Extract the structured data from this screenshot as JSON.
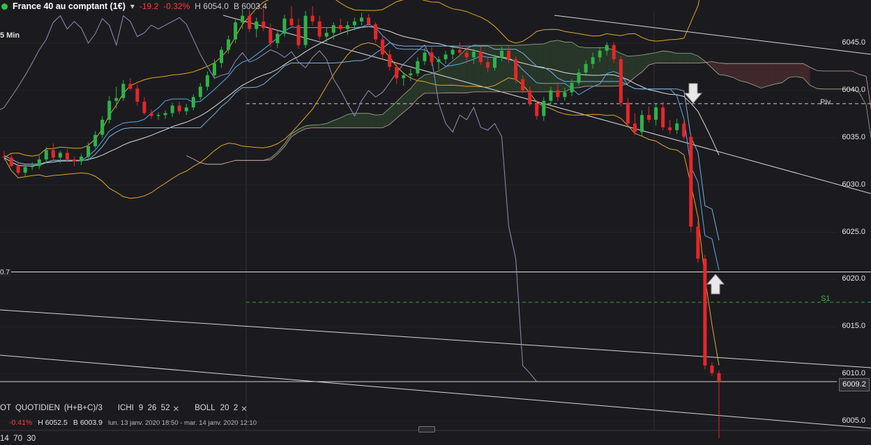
{
  "header": {
    "instrument": "France 40 au comptant (1€)",
    "change": "-19.2",
    "change_pct": "-0.32%",
    "high": "H 6054.0",
    "bid": "B 6003.4"
  },
  "timeframe_label": "5 Min",
  "price_axis": [
    "6045.0",
    "6040.0",
    "6035.0",
    "6030.0",
    "6025.0",
    "6020.0",
    "6015.0",
    "6010.0",
    "6005.0"
  ],
  "current_price": "6009.2",
  "left_tag": "0.7",
  "levels": {
    "pivot_label": "Piv",
    "s1_label": "S1"
  },
  "indicators": {
    "pivot_prefix": "OT",
    "pivot_type": "QUOTIDIEN",
    "pivot_formula": "(H+B+C)/3",
    "ichi_name": "ICHI",
    "ichi_params": "9  26  52",
    "boll_name": "BOLL",
    "boll_params": "20  2",
    "close_glyph": "✕"
  },
  "info": {
    "pct": "-0.41%",
    "high": "H 6052.5",
    "bid": "B 6003.9",
    "range": "lun. 13 janv. 2020 18:50 - mar. 14 janv. 2020 12:10"
  },
  "oscillator_params": "14  70  30",
  "colors": {
    "bull": "#2db34a",
    "bear": "#e8252a",
    "bollinger": "#e2a62a",
    "tenkan": "#5aa9e6",
    "kijun": "#e6e6e6",
    "chikou": "#8f8fb8",
    "cloud_green": "#2a3d2a",
    "cloud_red": "#4a2a2e",
    "pivot": "#d0d0d0",
    "s1": "#3f9c3f"
  },
  "chart_data": {
    "type": "candlestick",
    "timeframe": "5 Min",
    "ylim": [
      6003,
      6049
    ],
    "pivot": 6038.6,
    "s1": 6017.6,
    "horizontal_line": 6020.8,
    "current_line": 6009.2,
    "candles": [
      [
        6033.0,
        6033.6,
        6032.6,
        6032.9
      ],
      [
        6032.9,
        6033.3,
        6031.9,
        6032.0
      ],
      [
        6032.0,
        6032.5,
        6031.1,
        6031.3
      ],
      [
        6031.3,
        6032.2,
        6030.8,
        6031.9
      ],
      [
        6031.9,
        6032.4,
        6031.6,
        6032.0
      ],
      [
        6032.0,
        6033.1,
        6031.7,
        6032.7
      ],
      [
        6032.7,
        6034.0,
        6032.3,
        6033.7
      ],
      [
        6033.7,
        6034.4,
        6032.6,
        6032.9
      ],
      [
        6032.9,
        6033.6,
        6032.3,
        6033.4
      ],
      [
        6033.4,
        6033.8,
        6032.4,
        6032.7
      ],
      [
        6032.7,
        6033.0,
        6032.0,
        6032.5
      ],
      [
        6032.5,
        6033.3,
        6032.1,
        6033.0
      ],
      [
        6033.0,
        6034.5,
        6032.6,
        6034.1
      ],
      [
        6034.1,
        6035.7,
        6033.9,
        6035.3
      ],
      [
        6035.3,
        6037.3,
        6035.0,
        6036.9
      ],
      [
        6036.9,
        6039.4,
        6036.5,
        6038.9
      ],
      [
        6038.9,
        6040.4,
        6038.1,
        6039.2
      ],
      [
        6039.2,
        6041.1,
        6038.9,
        6040.7
      ],
      [
        6040.7,
        6041.3,
        6040.0,
        6040.2
      ],
      [
        6040.2,
        6040.6,
        6038.4,
        6038.8
      ],
      [
        6038.8,
        6039.3,
        6037.4,
        6037.6
      ],
      [
        6037.6,
        6038.0,
        6037.0,
        6037.3
      ],
      [
        6037.3,
        6037.7,
        6036.9,
        6037.4
      ],
      [
        6037.4,
        6037.9,
        6037.0,
        6037.6
      ],
      [
        6037.6,
        6038.7,
        6037.2,
        6038.4
      ],
      [
        6038.4,
        6038.8,
        6037.5,
        6037.8
      ],
      [
        6037.8,
        6038.6,
        6037.4,
        6038.2
      ],
      [
        6038.2,
        6039.6,
        6037.9,
        6039.3
      ],
      [
        6039.3,
        6040.8,
        6039.0,
        6040.4
      ],
      [
        6040.4,
        6042.0,
        6040.0,
        6041.6
      ],
      [
        6041.6,
        6043.3,
        6041.2,
        6042.9
      ],
      [
        6042.9,
        6044.6,
        6042.4,
        6044.3
      ],
      [
        6044.3,
        6045.8,
        6043.9,
        6045.4
      ],
      [
        6045.4,
        6047.5,
        6045.0,
        6047.2
      ],
      [
        6047.2,
        6048.6,
        6046.5,
        6047.9
      ],
      [
        6047.9,
        6048.5,
        6046.2,
        6046.5
      ],
      [
        6046.5,
        6047.7,
        6045.6,
        6047.3
      ],
      [
        6047.3,
        6048.7,
        6046.3,
        6046.6
      ],
      [
        6046.6,
        6047.1,
        6044.6,
        6045.0
      ],
      [
        6045.0,
        6046.4,
        6044.5,
        6046.0
      ],
      [
        6046.0,
        6048.0,
        6045.7,
        6047.6
      ],
      [
        6047.6,
        6048.9,
        6046.6,
        6046.9
      ],
      [
        6046.9,
        6047.6,
        6044.4,
        6044.8
      ],
      [
        6044.8,
        6048.4,
        6044.5,
        6047.9
      ],
      [
        6047.9,
        6048.9,
        6046.9,
        6047.3
      ],
      [
        6047.3,
        6047.9,
        6045.4,
        6045.7
      ],
      [
        6045.7,
        6046.6,
        6045.1,
        6046.1
      ],
      [
        6046.1,
        6047.2,
        6045.4,
        6046.9
      ],
      [
        6046.9,
        6047.6,
        6046.1,
        6046.5
      ],
      [
        6046.5,
        6047.3,
        6045.9,
        6046.9
      ],
      [
        6046.9,
        6047.7,
        6046.4,
        6047.3
      ],
      [
        6047.3,
        6048.2,
        6046.9,
        6047.7
      ],
      [
        6047.7,
        6048.1,
        6046.7,
        6047.0
      ],
      [
        6047.0,
        6047.2,
        6045.1,
        6045.4
      ],
      [
        6045.4,
        6045.8,
        6043.4,
        6043.8
      ],
      [
        6043.8,
        6044.3,
        6042.1,
        6042.5
      ],
      [
        6042.5,
        6043.0,
        6040.7,
        6041.3
      ],
      [
        6041.3,
        6041.9,
        6040.5,
        6041.6
      ],
      [
        6041.6,
        6042.3,
        6041.0,
        6041.8
      ],
      [
        6041.8,
        6043.5,
        6041.5,
        6043.1
      ],
      [
        6043.1,
        6044.5,
        6042.7,
        6044.0
      ],
      [
        6044.0,
        6044.6,
        6042.6,
        6043.0
      ],
      [
        6043.0,
        6043.6,
        6042.2,
        6043.3
      ],
      [
        6043.3,
        6044.2,
        6042.8,
        6043.8
      ],
      [
        6043.8,
        6044.8,
        6043.3,
        6044.3
      ],
      [
        6044.3,
        6045.1,
        6043.6,
        6044.0
      ],
      [
        6044.0,
        6044.6,
        6042.9,
        6043.5
      ],
      [
        6043.5,
        6044.4,
        6042.8,
        6044.1
      ],
      [
        6044.1,
        6044.7,
        6042.7,
        6043.0
      ],
      [
        6043.0,
        6043.6,
        6041.9,
        6042.4
      ],
      [
        6042.4,
        6043.8,
        6042.1,
        6043.5
      ],
      [
        6043.5,
        6044.6,
        6043.1,
        6044.2
      ],
      [
        6044.2,
        6044.7,
        6042.9,
        6043.3
      ],
      [
        6043.3,
        6043.6,
        6040.8,
        6041.2
      ],
      [
        6041.2,
        6041.6,
        6039.7,
        6040.0
      ],
      [
        6040.0,
        6040.4,
        6038.3,
        6038.6
      ],
      [
        6038.6,
        6039.0,
        6036.9,
        6037.3
      ],
      [
        6037.3,
        6039.3,
        6036.8,
        6038.9
      ],
      [
        6038.9,
        6040.4,
        6038.5,
        6040.0
      ],
      [
        6040.0,
        6040.9,
        6038.9,
        6039.3
      ],
      [
        6039.3,
        6040.3,
        6038.9,
        6039.8
      ],
      [
        6039.8,
        6041.2,
        6039.4,
        6040.8
      ],
      [
        6040.8,
        6042.3,
        6040.5,
        6041.9
      ],
      [
        6041.9,
        6043.2,
        6041.5,
        6042.8
      ],
      [
        6042.8,
        6044.0,
        6042.3,
        6043.5
      ],
      [
        6043.5,
        6044.6,
        6043.0,
        6044.2
      ],
      [
        6044.2,
        6045.1,
        6043.7,
        6044.8
      ],
      [
        6044.8,
        6045.1,
        6042.9,
        6043.3
      ],
      [
        6043.3,
        6043.6,
        6038.3,
        6038.7
      ],
      [
        6038.7,
        6039.2,
        6036.0,
        6036.5
      ],
      [
        6036.5,
        6037.6,
        6035.3,
        6035.6
      ],
      [
        6035.6,
        6037.9,
        6035.2,
        6037.4
      ],
      [
        6037.4,
        6038.3,
        6036.6,
        6036.9
      ],
      [
        6036.9,
        6038.6,
        6036.3,
        6038.2
      ],
      [
        6038.2,
        6038.8,
        6035.8,
        6036.1
      ],
      [
        6036.1,
        6036.9,
        6035.4,
        6035.8
      ],
      [
        6035.8,
        6037.0,
        6035.4,
        6036.5
      ],
      [
        6036.5,
        6036.9,
        6034.8,
        6035.1
      ],
      [
        6035.1,
        6035.4,
        6025.0,
        6025.6
      ],
      [
        6025.6,
        6026.2,
        6021.8,
        6022.2
      ],
      [
        6022.2,
        6022.6,
        6010.5,
        6010.9
      ],
      [
        6010.9,
        6011.2,
        6009.8,
        6010.1
      ],
      [
        6010.1,
        6010.4,
        6003.2,
        6009.2
      ]
    ]
  }
}
